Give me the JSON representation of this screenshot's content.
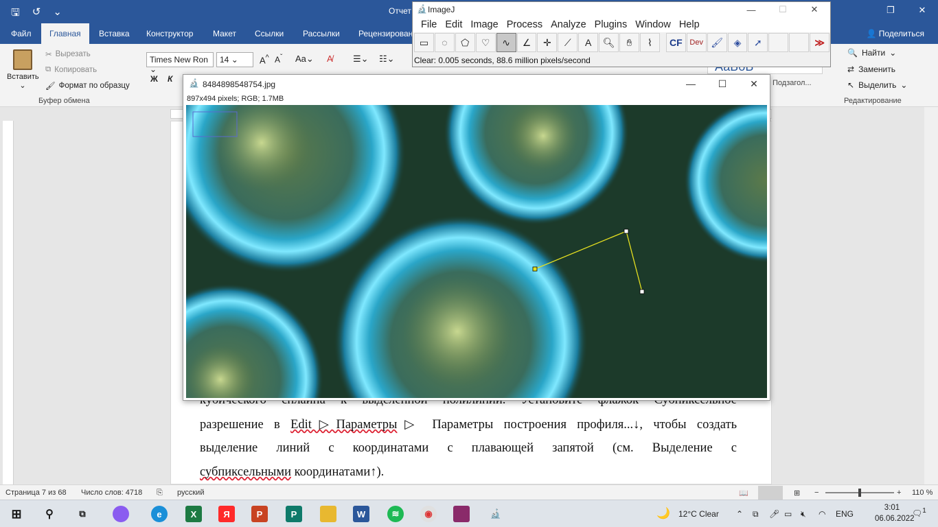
{
  "word": {
    "doc_title": "Отчет",
    "tabs": [
      "Файл",
      "Главная",
      "Вставка",
      "Конструктор",
      "Макет",
      "Ссылки",
      "Рассылки",
      "Рецензирован"
    ],
    "active_tab": "Главная",
    "share": "Поделиться",
    "clipboard": {
      "paste": "Вставить",
      "cut": "Вырезать",
      "copy": "Копировать",
      "format_painter": "Формат по образцу",
      "group_label": "Буфер обмена"
    },
    "font": {
      "name": "Times New Ron",
      "size": "14"
    },
    "styles": {
      "sample": "АаБбВ",
      "heading": "Подзагол..."
    },
    "editing": {
      "find": "Найти",
      "replace": "Заменить",
      "select": "Выделить",
      "group_label": "Редактирование"
    },
    "body": {
      "line1": "кубического сплайна к выделенной полилинии. Установите флажок Субпиксельное",
      "line2_a": "разрешение в ",
      "line2_b": "Edit▷Параметры",
      "line2_c": "▷ Параметры построения профиля...↓, чтобы создать",
      "line3": "выделение линий с координатами с плавающей запятой (см. Выделение с",
      "line4_a": "субпиксельными",
      "line4_b": " координатами↑)."
    },
    "status": {
      "page": "Страница 7 из 68",
      "words": "Число слов: 4718",
      "lang": "русский",
      "zoom": "110 %"
    }
  },
  "imagej": {
    "title": "ImageJ",
    "menu": [
      "File",
      "Edit",
      "Image",
      "Process",
      "Analyze",
      "Plugins",
      "Window",
      "Help"
    ],
    "status": "Clear: 0.005 seconds, 88.6 million pixels/second",
    "tools": [
      "rectangle-icon",
      "oval-icon",
      "polygon-icon",
      "freehand-icon",
      "polyline-icon",
      "angle-icon",
      "point-icon",
      "wand-icon",
      "text-icon",
      "magnifier-icon",
      "hand-icon",
      "dropper-icon",
      "cf-icon",
      "dev-icon",
      "brush-icon",
      "flood-icon",
      "arrow-icon",
      "blank-icon",
      "blank-icon",
      "more-icon"
    ],
    "cf_label": "CF",
    "dev_label": "Dev"
  },
  "image_window": {
    "title": "8484898548754.jpg",
    "info": "897x494 pixels; RGB; 1.7MB"
  },
  "taskbar": {
    "weather": "12°C  Clear",
    "lang": "ENG",
    "time": "3:01",
    "date": "06.06.2022",
    "notifications": "1"
  }
}
